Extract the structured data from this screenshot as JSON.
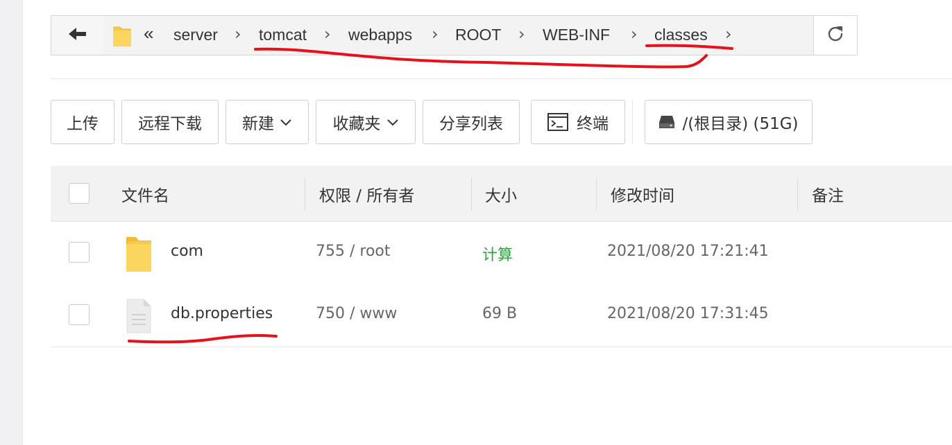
{
  "breadcrumb": {
    "overflow_label": "«",
    "items": [
      "server",
      "tomcat",
      "webapps",
      "ROOT",
      "WEB-INF",
      "classes"
    ],
    "separator": "›"
  },
  "toolbar": {
    "upload": "上传",
    "remote_download": "远程下载",
    "new": "新建",
    "favorites": "收藏夹",
    "share_list": "分享列表",
    "terminal": "终端",
    "disk": "/(根目录) (51G)"
  },
  "table": {
    "headers": [
      "文件名",
      "权限 / 所有者",
      "大小",
      "修改时间",
      "备注"
    ],
    "rows": [
      {
        "name": "com",
        "perm": "755 / root",
        "size": "计算",
        "mtime": "2021/08/20 17:21:41",
        "type": "folder"
      },
      {
        "name": "db.properties",
        "perm": "750 / www",
        "size": "69 B",
        "mtime": "2021/08/20 17:31:45",
        "type": "file"
      }
    ]
  },
  "colors": {
    "accent_green": "#2ea13a",
    "annotation_red": "#e8101a",
    "folder_yellow": "#f7c948"
  },
  "icons": {
    "back": "arrow-left-icon",
    "refresh": "refresh-icon",
    "folder": "folder-icon",
    "file": "file-icon",
    "terminal": "terminal-icon",
    "disk": "disk-icon",
    "chevron": "chevron-down-icon"
  }
}
